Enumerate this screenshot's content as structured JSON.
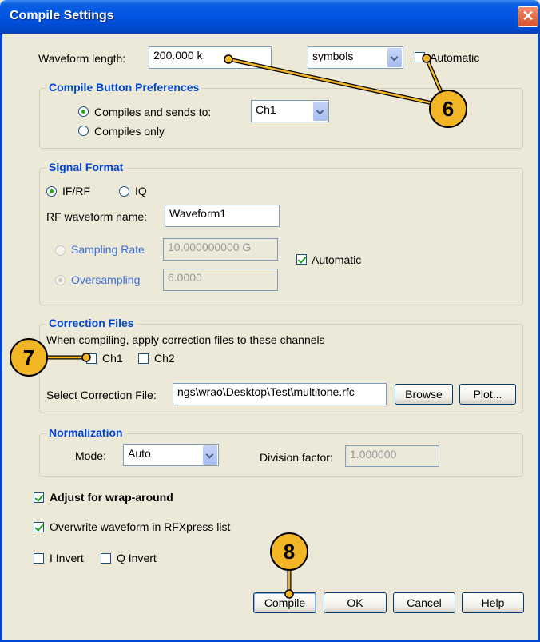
{
  "window": {
    "title": "Compile Settings",
    "close_glyph": "✕"
  },
  "waveform_length": {
    "label": "Waveform length:",
    "value": "200.000 k",
    "unit": "symbols",
    "automatic_label": "Automatic",
    "automatic_checked": false
  },
  "compile_prefs": {
    "legend": "Compile Button Preferences",
    "option_send": "Compiles and sends to:",
    "option_only": "Compiles only",
    "selected": "send",
    "channel": "Ch1"
  },
  "signal_format": {
    "legend": "Signal Format",
    "option_ifrf": "IF/RF",
    "option_iq": "IQ",
    "selected": "IF/RF",
    "rf_name_label": "RF waveform name:",
    "rf_name_value": "Waveform1",
    "sampling_rate_label": "Sampling Rate",
    "sampling_rate_value": "10.000000000 G",
    "oversampling_label": "Oversampling",
    "oversampling_value": "6.0000",
    "automatic_label": "Automatic",
    "automatic_checked": true
  },
  "correction_files": {
    "legend": "Correction Files",
    "description": "When compiling, apply correction files to these channels",
    "ch1_label": "Ch1",
    "ch2_label": "Ch2",
    "select_label": "Select Correction File:",
    "file_value": "ngs\\wrao\\Desktop\\Test\\multitone.rfc",
    "browse_label": "Browse",
    "plot_label": "Plot..."
  },
  "normalization": {
    "legend": "Normalization",
    "mode_label": "Mode:",
    "mode_value": "Auto",
    "division_label": "Division factor:",
    "division_value": "1.000000"
  },
  "options": {
    "wrap_label": "Adjust for wrap-around",
    "wrap_checked": true,
    "overwrite_label": "Overwrite waveform in RFXpress list",
    "overwrite_checked": true,
    "i_invert_label": "I Invert",
    "q_invert_label": "Q Invert"
  },
  "buttons": {
    "compile": "Compile",
    "ok": "OK",
    "cancel": "Cancel",
    "help": "Help"
  },
  "callouts": {
    "six": "6",
    "seven": "7",
    "eight": "8"
  },
  "colors": {
    "title_bar": "#0054e3",
    "legend_text": "#0046d5",
    "callout_fill": "#f2b526",
    "dialog_bg": "#ece9d8"
  }
}
